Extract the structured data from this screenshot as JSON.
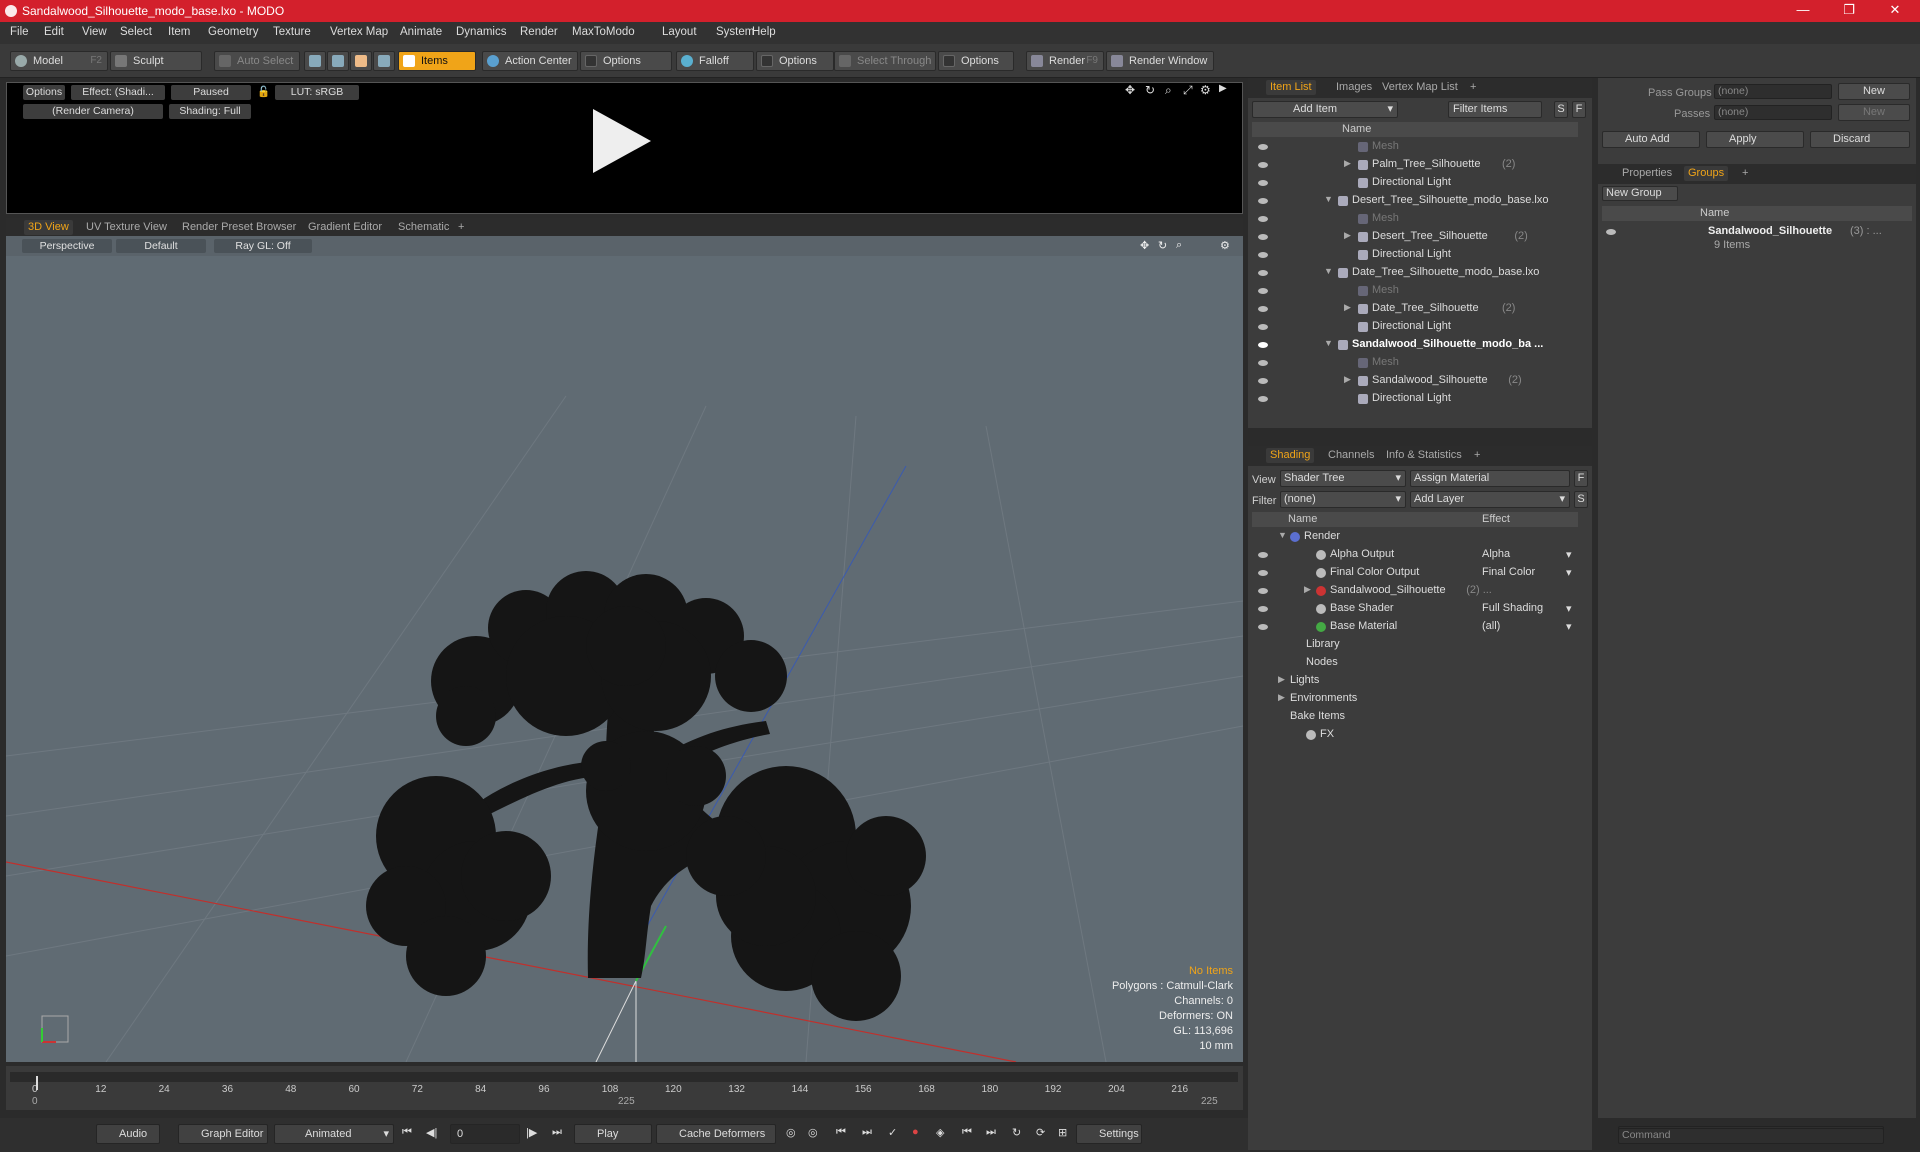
{
  "window": {
    "title": "Sandalwood_Silhouette_modo_base.lxo - MODO"
  },
  "menu": [
    "File",
    "Edit",
    "View",
    "Select",
    "Item",
    "Geometry",
    "Texture",
    "Vertex Map",
    "Animate",
    "Dynamics",
    "Render",
    "MaxToModo",
    "Layout",
    "System",
    "Help"
  ],
  "toolbar": {
    "model": "Model",
    "model_key": "F2",
    "sculpt": "Sculpt",
    "auto_select": "Auto Select",
    "items": "Items",
    "action_center": "Action Center",
    "options1": "Options",
    "falloff": "Falloff",
    "options2": "Options",
    "select_through": "Select Through",
    "options3": "Options",
    "render": "Render",
    "render_key": "F9",
    "render_window": "Render Window"
  },
  "preview": {
    "options": "Options",
    "effect": "Effect: (Shadi...",
    "paused": "Paused",
    "lut": "LUT: sRGB",
    "camera": "(Render Camera)",
    "shading": "Shading: Full"
  },
  "viewport_tabs": [
    "3D View",
    "UV Texture View",
    "Render Preset Browser",
    "Gradient Editor",
    "Schematic",
    "+"
  ],
  "viewport": {
    "perspective": "Perspective",
    "default": "Default",
    "raygl": "Ray GL: Off",
    "stats": {
      "items": "No Items",
      "polygons": "Polygons : Catmull-Clark",
      "channels": "Channels: 0",
      "deformers": "Deformers: ON",
      "gl": "GL: 113,696",
      "unit": "10 mm"
    }
  },
  "timeline": {
    "ticks": [
      "0",
      "12",
      "24",
      "36",
      "48",
      "60",
      "72",
      "84",
      "96",
      "108",
      "120",
      "132",
      "144",
      "156",
      "168",
      "180",
      "192",
      "204",
      "216"
    ],
    "start": "0",
    "mid": "225",
    "end": "225"
  },
  "bottom": {
    "audio": "Audio",
    "graph_editor": "Graph Editor",
    "animated": "Animated",
    "frame": "0",
    "play": "Play",
    "cache": "Cache Deformers",
    "settings": "Settings"
  },
  "item_list": {
    "tabs": [
      "Item List",
      "Images",
      "Vertex Map List",
      "+"
    ],
    "add_item": "Add Item",
    "filter": "Filter Items",
    "s": "S",
    "f": "F",
    "col_name": "Name",
    "rows": [
      {
        "label": "Mesh",
        "dim": true,
        "indent": 2
      },
      {
        "label": "Palm_Tree_Silhouette",
        "count": "(2)",
        "indent": 2,
        "arrow": "▶"
      },
      {
        "label": "Directional Light",
        "indent": 2
      },
      {
        "label": "Desert_Tree_Silhouette_modo_base.lxo",
        "indent": 1,
        "arrow": "▼"
      },
      {
        "label": "Mesh",
        "dim": true,
        "indent": 2
      },
      {
        "label": "Desert_Tree_Silhouette",
        "count": "(2)",
        "indent": 2,
        "arrow": "▶"
      },
      {
        "label": "Directional Light",
        "indent": 2
      },
      {
        "label": "Date_Tree_Silhouette_modo_base.lxo",
        "indent": 1,
        "arrow": "▼"
      },
      {
        "label": "Mesh",
        "dim": true,
        "indent": 2
      },
      {
        "label": "Date_Tree_Silhouette",
        "count": "(2)",
        "indent": 2,
        "arrow": "▶"
      },
      {
        "label": "Directional Light",
        "indent": 2
      },
      {
        "label": "Sandalwood_Silhouette_modo_ba ...",
        "indent": 1,
        "arrow": "▼",
        "bold": true
      },
      {
        "label": "Mesh",
        "dim": true,
        "indent": 2
      },
      {
        "label": "Sandalwood_Silhouette",
        "count": "(2)",
        "indent": 2,
        "arrow": "▶"
      },
      {
        "label": "Directional Light",
        "indent": 2
      }
    ]
  },
  "shading": {
    "tabs": [
      "Shading",
      "Channels",
      "Info & Statistics",
      "+"
    ],
    "view_label": "View",
    "view_value": "Shader Tree",
    "assign": "Assign Material",
    "f": "F",
    "filter_label": "Filter",
    "filter_value": "(none)",
    "add_layer": "Add Layer",
    "s": "S",
    "col_name": "Name",
    "col_effect": "Effect",
    "rows": [
      {
        "label": "Render",
        "effect": "",
        "indent": 0,
        "arrow": "▼",
        "eye": false
      },
      {
        "label": "Alpha Output",
        "effect": "Alpha",
        "indent": 1,
        "eye": true
      },
      {
        "label": "Final Color Output",
        "effect": "Final Color",
        "indent": 1,
        "eye": true
      },
      {
        "label": "Sandalwood_Silhouette",
        "count": "(2) ...",
        "effect": "",
        "indent": 1,
        "arrow": "▶",
        "eye": true
      },
      {
        "label": "Base Shader",
        "effect": "Full Shading",
        "indent": 1,
        "eye": true
      },
      {
        "label": "Base Material",
        "effect": "(all)",
        "indent": 1,
        "eye": true
      },
      {
        "label": "Library",
        "effect": "",
        "indent": 0.6,
        "eye": false
      },
      {
        "label": "Nodes",
        "effect": "",
        "indent": 0.6,
        "eye": false
      },
      {
        "label": "Lights",
        "effect": "",
        "indent": 0,
        "arrow": "▶",
        "eye": false
      },
      {
        "label": "Environments",
        "effect": "",
        "indent": 0,
        "arrow": "▶",
        "eye": false
      },
      {
        "label": "Bake Items",
        "effect": "",
        "indent": 0,
        "eye": false
      },
      {
        "label": "FX",
        "effect": "",
        "indent": 0.6,
        "eye": false
      }
    ]
  },
  "groups_panel": {
    "pass_groups": "Pass Groups",
    "passes": "Passes",
    "none": "(none)",
    "new": "New",
    "auto_add": "Auto Add",
    "apply": "Apply",
    "discard": "Discard",
    "tabs": [
      "Properties",
      "Groups",
      "+"
    ],
    "new_group": "New Group",
    "col_name": "Name",
    "group_name": "Sandalwood_Silhouette",
    "group_count": "(3) : ...",
    "group_items": "9 Items"
  },
  "command": {
    "placeholder": "Command"
  }
}
